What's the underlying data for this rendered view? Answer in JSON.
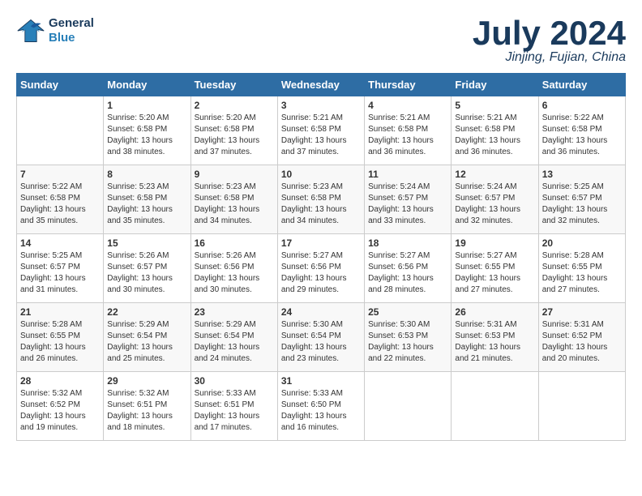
{
  "header": {
    "logo_line1": "General",
    "logo_line2": "Blue",
    "month_year": "July 2024",
    "location": "Jinjing, Fujian, China"
  },
  "columns": [
    "Sunday",
    "Monday",
    "Tuesday",
    "Wednesday",
    "Thursday",
    "Friday",
    "Saturday"
  ],
  "weeks": [
    [
      {
        "day": "",
        "info": ""
      },
      {
        "day": "1",
        "info": "Sunrise: 5:20 AM\nSunset: 6:58 PM\nDaylight: 13 hours\nand 38 minutes."
      },
      {
        "day": "2",
        "info": "Sunrise: 5:20 AM\nSunset: 6:58 PM\nDaylight: 13 hours\nand 37 minutes."
      },
      {
        "day": "3",
        "info": "Sunrise: 5:21 AM\nSunset: 6:58 PM\nDaylight: 13 hours\nand 37 minutes."
      },
      {
        "day": "4",
        "info": "Sunrise: 5:21 AM\nSunset: 6:58 PM\nDaylight: 13 hours\nand 36 minutes."
      },
      {
        "day": "5",
        "info": "Sunrise: 5:21 AM\nSunset: 6:58 PM\nDaylight: 13 hours\nand 36 minutes."
      },
      {
        "day": "6",
        "info": "Sunrise: 5:22 AM\nSunset: 6:58 PM\nDaylight: 13 hours\nand 36 minutes."
      }
    ],
    [
      {
        "day": "7",
        "info": "Sunrise: 5:22 AM\nSunset: 6:58 PM\nDaylight: 13 hours\nand 35 minutes."
      },
      {
        "day": "8",
        "info": "Sunrise: 5:23 AM\nSunset: 6:58 PM\nDaylight: 13 hours\nand 35 minutes."
      },
      {
        "day": "9",
        "info": "Sunrise: 5:23 AM\nSunset: 6:58 PM\nDaylight: 13 hours\nand 34 minutes."
      },
      {
        "day": "10",
        "info": "Sunrise: 5:23 AM\nSunset: 6:58 PM\nDaylight: 13 hours\nand 34 minutes."
      },
      {
        "day": "11",
        "info": "Sunrise: 5:24 AM\nSunset: 6:57 PM\nDaylight: 13 hours\nand 33 minutes."
      },
      {
        "day": "12",
        "info": "Sunrise: 5:24 AM\nSunset: 6:57 PM\nDaylight: 13 hours\nand 32 minutes."
      },
      {
        "day": "13",
        "info": "Sunrise: 5:25 AM\nSunset: 6:57 PM\nDaylight: 13 hours\nand 32 minutes."
      }
    ],
    [
      {
        "day": "14",
        "info": "Sunrise: 5:25 AM\nSunset: 6:57 PM\nDaylight: 13 hours\nand 31 minutes."
      },
      {
        "day": "15",
        "info": "Sunrise: 5:26 AM\nSunset: 6:57 PM\nDaylight: 13 hours\nand 30 minutes."
      },
      {
        "day": "16",
        "info": "Sunrise: 5:26 AM\nSunset: 6:56 PM\nDaylight: 13 hours\nand 30 minutes."
      },
      {
        "day": "17",
        "info": "Sunrise: 5:27 AM\nSunset: 6:56 PM\nDaylight: 13 hours\nand 29 minutes."
      },
      {
        "day": "18",
        "info": "Sunrise: 5:27 AM\nSunset: 6:56 PM\nDaylight: 13 hours\nand 28 minutes."
      },
      {
        "day": "19",
        "info": "Sunrise: 5:27 AM\nSunset: 6:55 PM\nDaylight: 13 hours\nand 27 minutes."
      },
      {
        "day": "20",
        "info": "Sunrise: 5:28 AM\nSunset: 6:55 PM\nDaylight: 13 hours\nand 27 minutes."
      }
    ],
    [
      {
        "day": "21",
        "info": "Sunrise: 5:28 AM\nSunset: 6:55 PM\nDaylight: 13 hours\nand 26 minutes."
      },
      {
        "day": "22",
        "info": "Sunrise: 5:29 AM\nSunset: 6:54 PM\nDaylight: 13 hours\nand 25 minutes."
      },
      {
        "day": "23",
        "info": "Sunrise: 5:29 AM\nSunset: 6:54 PM\nDaylight: 13 hours\nand 24 minutes."
      },
      {
        "day": "24",
        "info": "Sunrise: 5:30 AM\nSunset: 6:54 PM\nDaylight: 13 hours\nand 23 minutes."
      },
      {
        "day": "25",
        "info": "Sunrise: 5:30 AM\nSunset: 6:53 PM\nDaylight: 13 hours\nand 22 minutes."
      },
      {
        "day": "26",
        "info": "Sunrise: 5:31 AM\nSunset: 6:53 PM\nDaylight: 13 hours\nand 21 minutes."
      },
      {
        "day": "27",
        "info": "Sunrise: 5:31 AM\nSunset: 6:52 PM\nDaylight: 13 hours\nand 20 minutes."
      }
    ],
    [
      {
        "day": "28",
        "info": "Sunrise: 5:32 AM\nSunset: 6:52 PM\nDaylight: 13 hours\nand 19 minutes."
      },
      {
        "day": "29",
        "info": "Sunrise: 5:32 AM\nSunset: 6:51 PM\nDaylight: 13 hours\nand 18 minutes."
      },
      {
        "day": "30",
        "info": "Sunrise: 5:33 AM\nSunset: 6:51 PM\nDaylight: 13 hours\nand 17 minutes."
      },
      {
        "day": "31",
        "info": "Sunrise: 5:33 AM\nSunset: 6:50 PM\nDaylight: 13 hours\nand 16 minutes."
      },
      {
        "day": "",
        "info": ""
      },
      {
        "day": "",
        "info": ""
      },
      {
        "day": "",
        "info": ""
      }
    ]
  ]
}
